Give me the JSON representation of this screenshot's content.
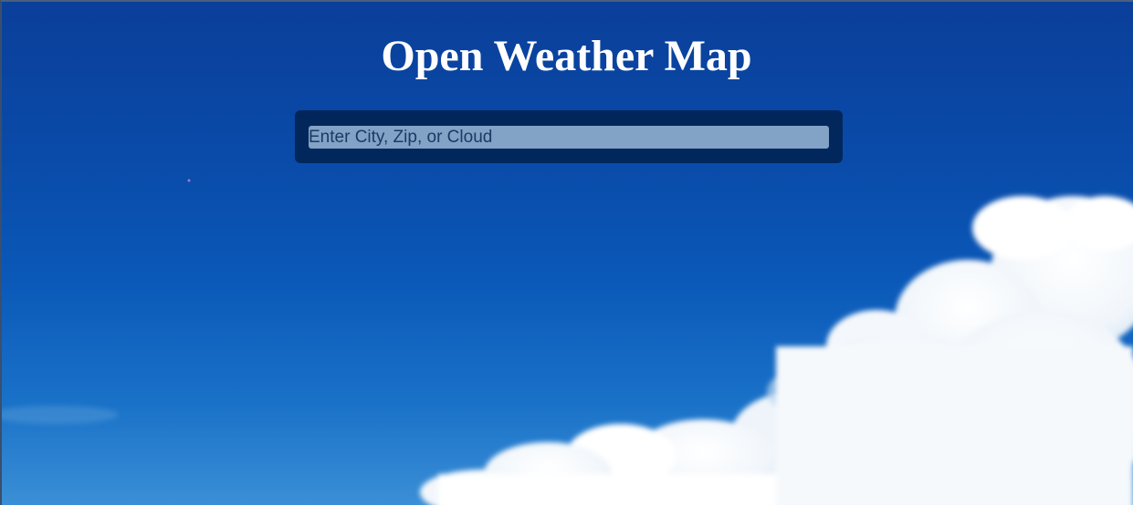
{
  "header": {
    "title": "Open Weather Map"
  },
  "search": {
    "placeholder": "Enter City, Zip, or Cloud",
    "value": ""
  },
  "background": {
    "description_icon": "cloud-sky-image"
  },
  "colors": {
    "sky_top": "#0a3f9a",
    "sky_bottom": "#3b8fd6",
    "panel": "#001e46",
    "input_bg": "#b4d2f0",
    "title_text": "#ffffff"
  }
}
